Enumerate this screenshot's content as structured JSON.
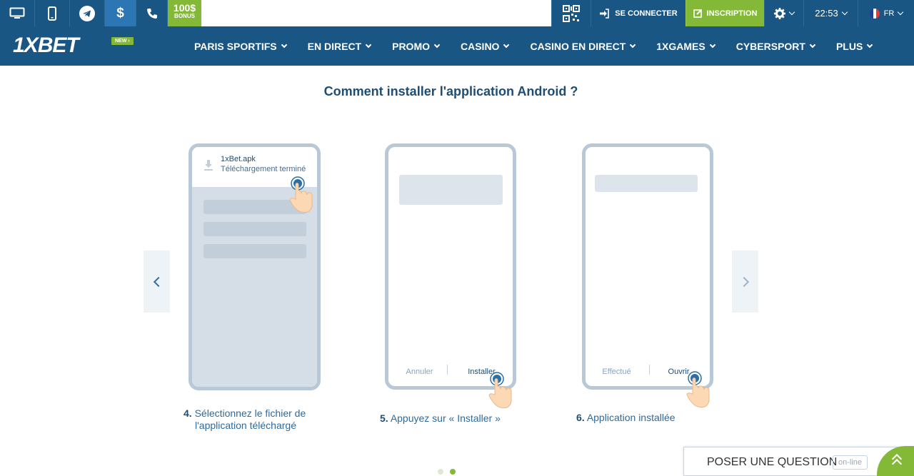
{
  "topbar": {
    "bonus_amount": "100$",
    "bonus_label": "BONUS",
    "login_label": "SE CONNECTER",
    "register_label": "INSCRIPTION",
    "time": "22:53",
    "language": "FR"
  },
  "nav": {
    "logo": "1XBET",
    "new_badge": "NEW",
    "items": [
      {
        "label": "PARIS SPORTIFS"
      },
      {
        "label": "EN DIRECT"
      },
      {
        "label": "PROMO"
      },
      {
        "label": "CASINO"
      },
      {
        "label": "CASINO EN DIRECT"
      },
      {
        "label": "1XGAMES"
      },
      {
        "label": "CYBERSPORT"
      },
      {
        "label": "PLUS"
      }
    ]
  },
  "main": {
    "title": "Comment installer l'application Android ?",
    "steps": [
      {
        "number": "4.",
        "caption_line1": "Sélectionnez le fichier de",
        "caption_line2": "l'application téléchargé",
        "file_name": "1xBet.apk",
        "file_status": "Téléchargement terminé"
      },
      {
        "number": "5.",
        "caption_line1": "Appuyez sur « Installer »",
        "cancel_label": "Annuler",
        "action_label": "Installer"
      },
      {
        "number": "6.",
        "caption_line1": "Application installée",
        "done_label": "Effectué",
        "action_label": "Ouvrir"
      }
    ],
    "carousel_active_index": 1
  },
  "chat": {
    "label": "POSER UNE QUESTION",
    "status": "on-line"
  },
  "colors": {
    "nav_bg": "#1a5684",
    "accent_green": "#84b937",
    "title": "#1f4d73"
  }
}
